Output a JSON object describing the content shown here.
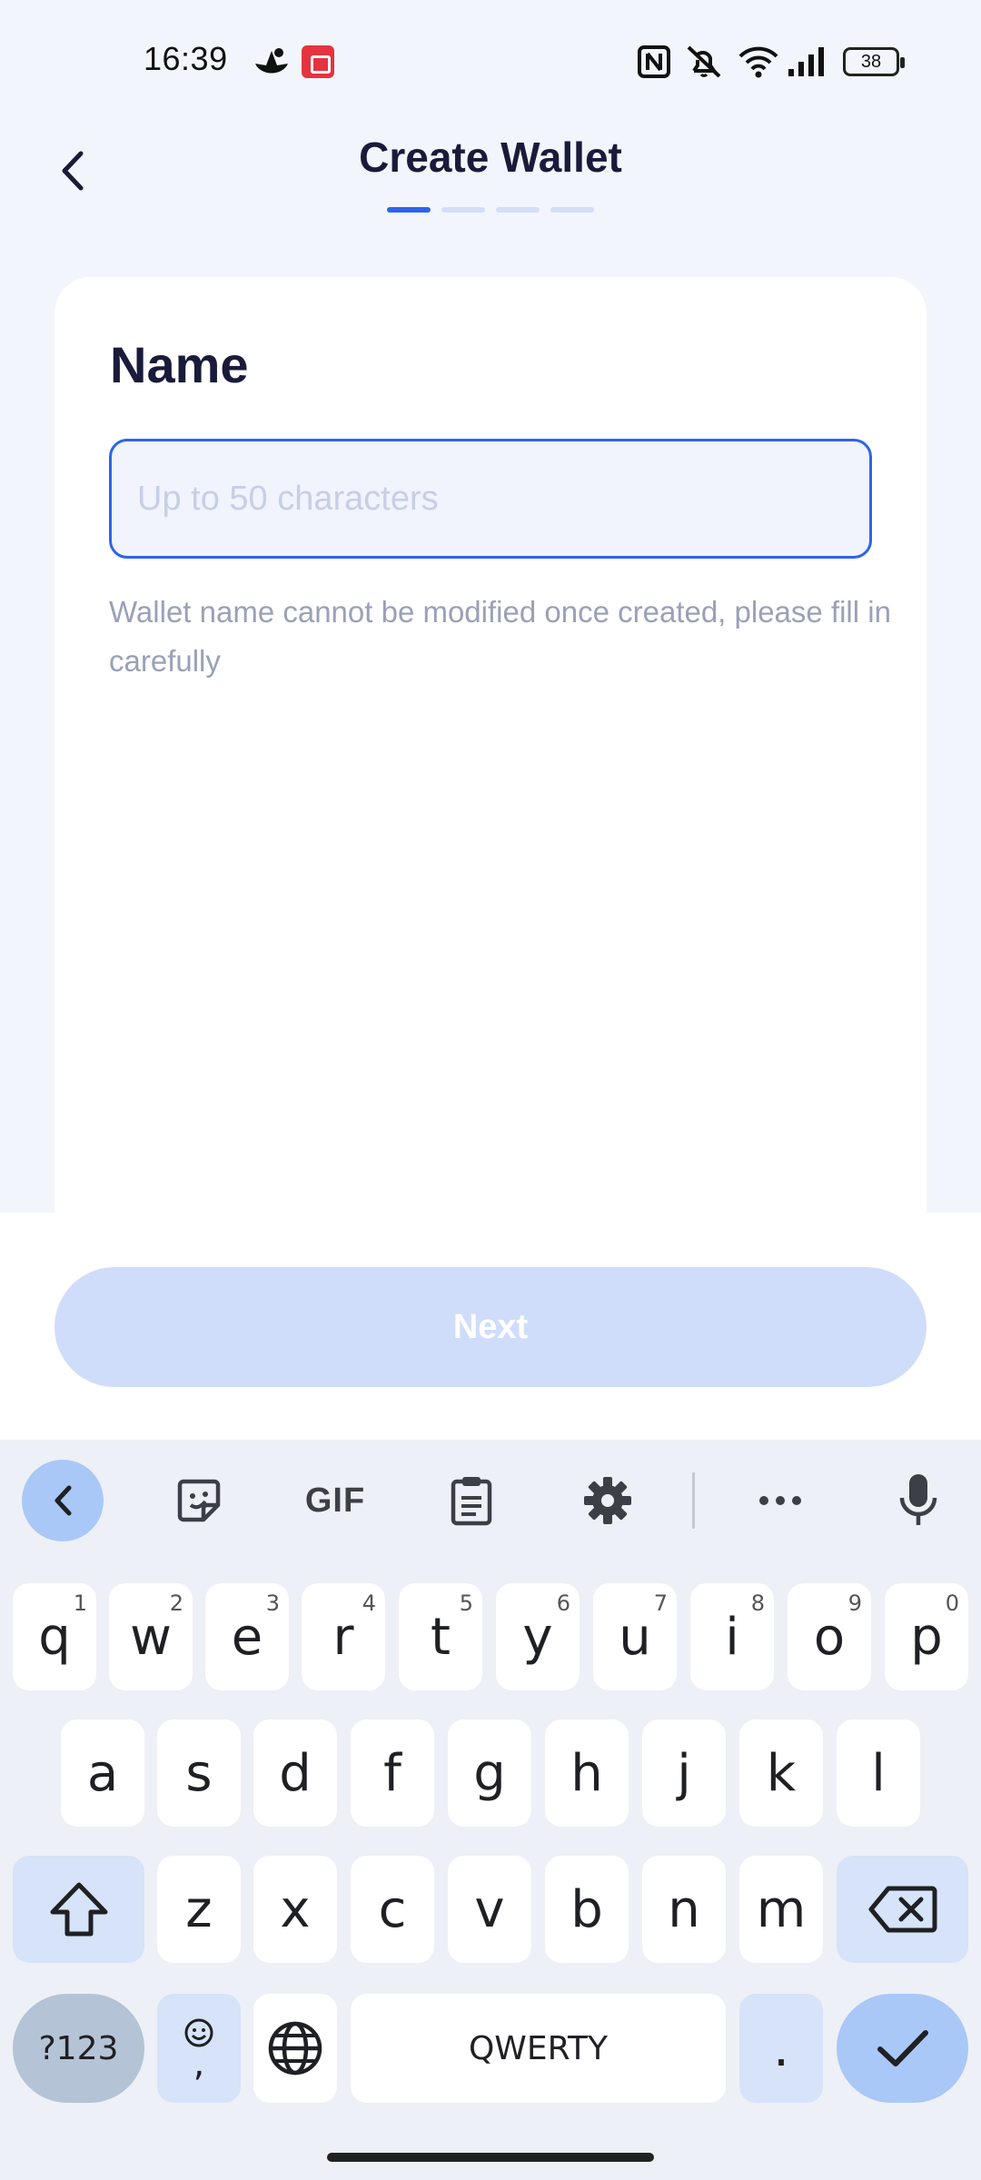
{
  "status_bar": {
    "time": "16:39",
    "battery": "38",
    "icons": [
      "app-notification-icon",
      "screen-record-icon",
      "nfc-icon",
      "mute-icon",
      "wifi-icon",
      "signal-icon",
      "battery-icon"
    ]
  },
  "header": {
    "title": "Create Wallet",
    "steps_total": 4,
    "step_current": 1
  },
  "form": {
    "label": "Name",
    "input_value": "",
    "input_placeholder": "Up to 50 characters",
    "hint": "Wallet name cannot be modified once created, please fill in carefully"
  },
  "footer": {
    "next_label": "Next"
  },
  "keyboard": {
    "toolbar": {
      "gif_label": "GIF"
    },
    "row1": [
      {
        "key": "q",
        "num": "1"
      },
      {
        "key": "w",
        "num": "2"
      },
      {
        "key": "e",
        "num": "3"
      },
      {
        "key": "r",
        "num": "4"
      },
      {
        "key": "t",
        "num": "5"
      },
      {
        "key": "y",
        "num": "6"
      },
      {
        "key": "u",
        "num": "7"
      },
      {
        "key": "i",
        "num": "8"
      },
      {
        "key": "o",
        "num": "9"
      },
      {
        "key": "p",
        "num": "0"
      }
    ],
    "row2": [
      "a",
      "s",
      "d",
      "f",
      "g",
      "h",
      "j",
      "k",
      "l"
    ],
    "row3": [
      "z",
      "x",
      "c",
      "v",
      "b",
      "n",
      "m"
    ],
    "symbols_label": "?123",
    "comma_label": ",",
    "space_label": "QWERTY",
    "period_label": "."
  },
  "colors": {
    "accent": "#2d64ea",
    "next_disabled": "#d0ddfa",
    "background": "#f3f5fc"
  }
}
